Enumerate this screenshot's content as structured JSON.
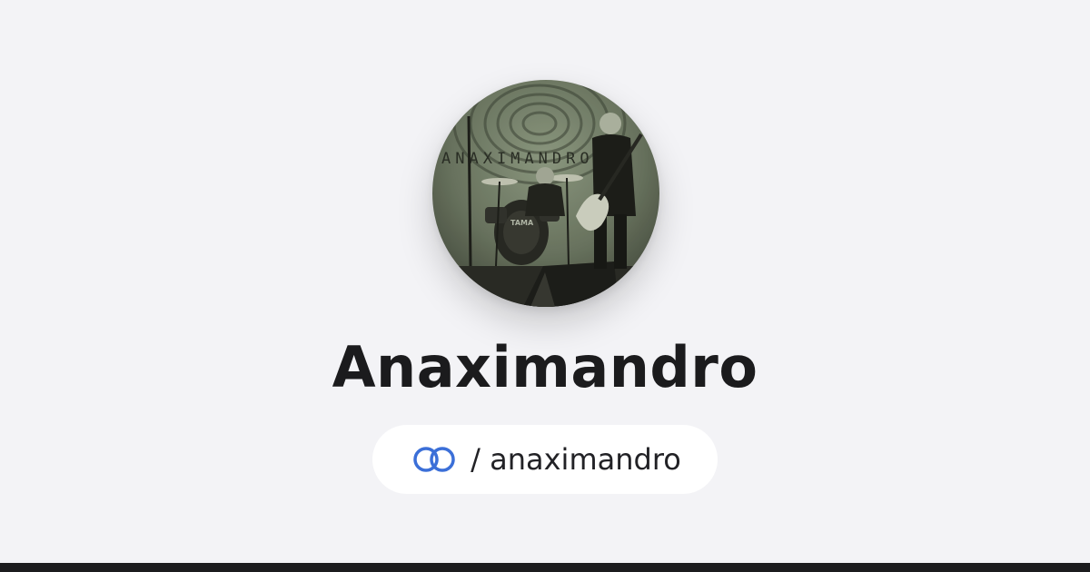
{
  "profile": {
    "name": "Anaximandro",
    "handle": "/ anaximandro",
    "avatar_banner_text": "ANAXIMANDRO",
    "avatar_drum_text": "TAMA"
  },
  "icons": {
    "brand": "linked-rings-icon"
  },
  "colors": {
    "background": "#f3f3f6",
    "accent": "#3b6fd8",
    "text": "#1b1b1d",
    "bottom_bar": "#1c1c1e"
  }
}
